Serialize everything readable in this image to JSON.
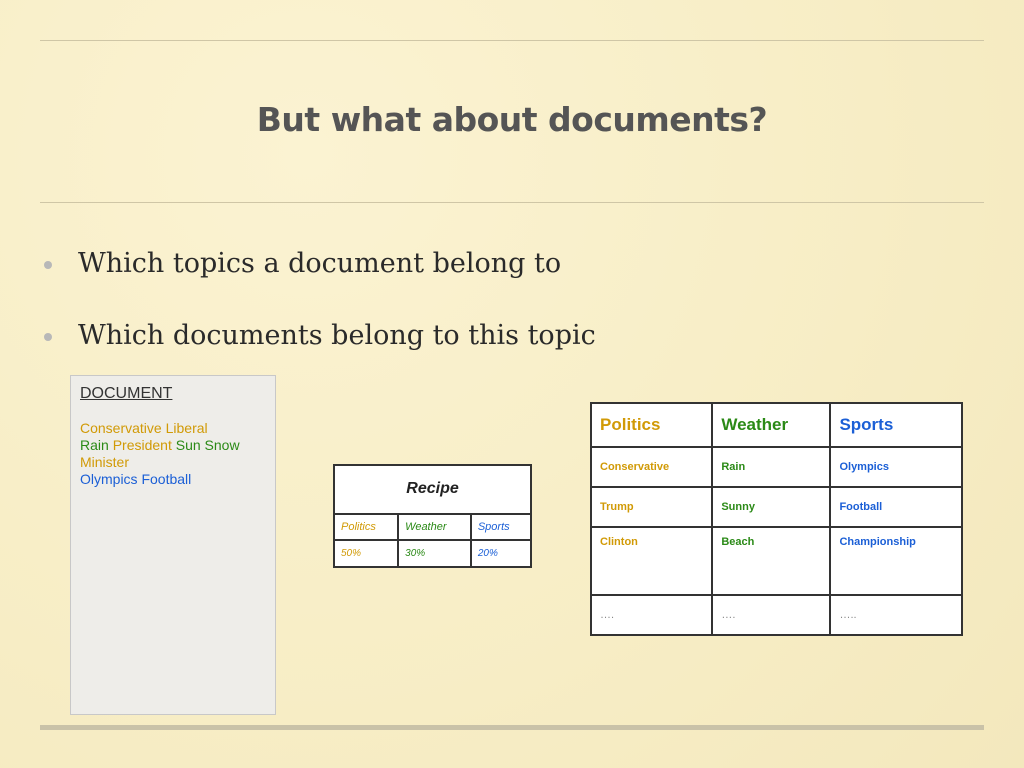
{
  "slide": {
    "title": "But what about documents?",
    "bullets": [
      "Which topics a document belong to",
      "Which documents belong to this topic"
    ]
  },
  "document_panel": {
    "heading": "DOCUMENT",
    "words": {
      "conservative": "Conservative",
      "liberal": "Liberal",
      "rain": "Rain",
      "president": "President",
      "sun": "Sun",
      "snow": "Snow",
      "minister": "Minister",
      "olympics": "Olympics",
      "football": "Football"
    }
  },
  "recipe_table": {
    "title": "Recipe",
    "categories": [
      "Politics",
      "Weather",
      "Sports"
    ],
    "percentages": [
      "50%",
      "30%",
      "20%"
    ]
  },
  "topics_table": {
    "headers": [
      "Politics",
      "Weather",
      "Sports"
    ],
    "rows": [
      [
        "Conservative",
        "Rain",
        "Olympics"
      ],
      [
        "Trump",
        "Sunny",
        "Football"
      ],
      [
        "Clinton",
        "Beach",
        "Championship"
      ],
      [
        "….",
        "….",
        "….."
      ]
    ]
  },
  "colors": {
    "politics": "#d19a06",
    "weather": "#2b8a17",
    "sports": "#1b5fd6",
    "background": "#f8efc8"
  }
}
